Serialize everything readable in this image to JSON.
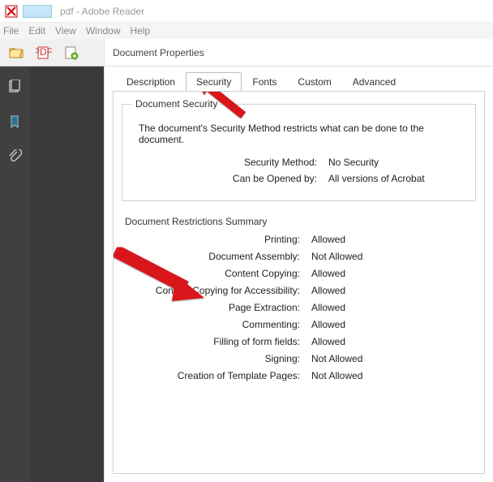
{
  "window": {
    "title": "pdf - Adobe Reader"
  },
  "menu": {
    "items": [
      "File",
      "Edit",
      "View",
      "Window",
      "Help"
    ]
  },
  "dialog": {
    "title": "Document Properties",
    "tabs": [
      "Description",
      "Security",
      "Fonts",
      "Custom",
      "Advanced"
    ],
    "active_tab": "Security",
    "security": {
      "group_title": "Document Security",
      "help": "The document's Security Method restricts what can be done to the document.",
      "method_label": "Security Method:",
      "method_value": "No Security",
      "opened_label": "Can be Opened by:",
      "opened_value": "All versions of Acrobat"
    },
    "restrictions": {
      "title": "Document Restrictions Summary",
      "rows": [
        {
          "label": "Printing:",
          "value": "Allowed"
        },
        {
          "label": "Document Assembly:",
          "value": "Not Allowed"
        },
        {
          "label": "Content Copying:",
          "value": "Allowed"
        },
        {
          "label": "Content Copying for Accessibility:",
          "value": "Allowed"
        },
        {
          "label": "Page Extraction:",
          "value": "Allowed"
        },
        {
          "label": "Commenting:",
          "value": "Allowed"
        },
        {
          "label": "Filling of form fields:",
          "value": "Allowed"
        },
        {
          "label": "Signing:",
          "value": "Not Allowed"
        },
        {
          "label": "Creation of Template Pages:",
          "value": "Not Allowed"
        }
      ]
    }
  }
}
